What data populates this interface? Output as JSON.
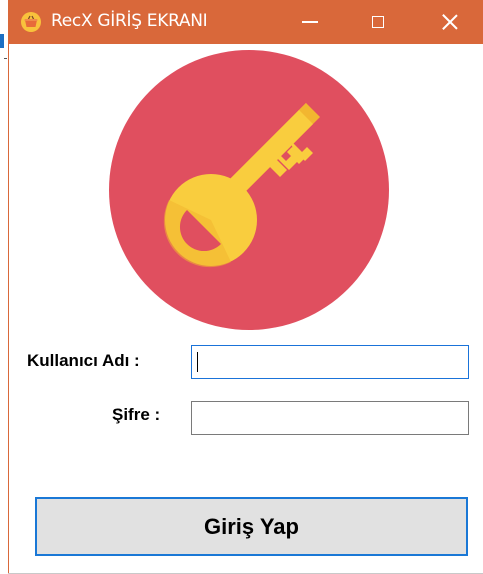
{
  "window": {
    "title": "RecX GİRİŞ EKRANI",
    "icon": "shopping-basket-icon",
    "titlebar_color": "#d9683a",
    "controls": {
      "minimize_icon": "minimize-icon",
      "maximize_icon": "maximize-icon",
      "close_icon": "close-icon"
    }
  },
  "logo": {
    "icon": "key-icon",
    "circle_color": "#e04f5f",
    "key_color": "#f9cd3e"
  },
  "form": {
    "username_label": "Kullanıcı Adı :",
    "username_value": "",
    "password_label": "Şifre :",
    "password_value": "",
    "submit_label": "Giriş Yap",
    "focus_color": "#1a73d9"
  }
}
